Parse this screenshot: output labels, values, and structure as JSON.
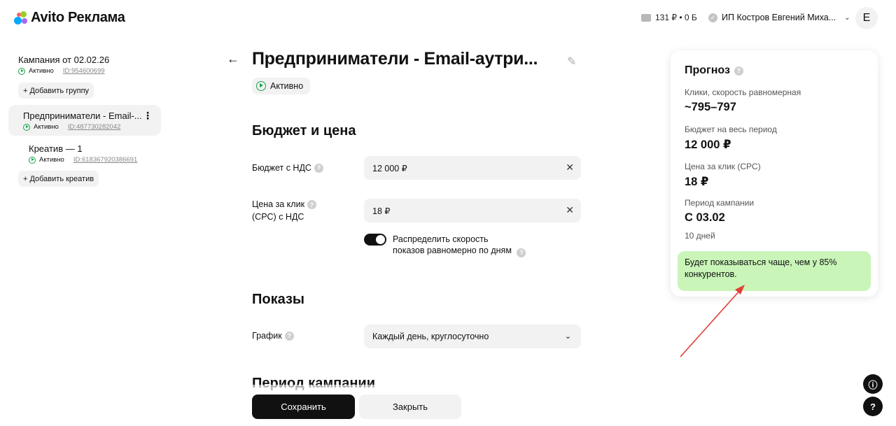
{
  "header": {
    "logo_text": "Avito Реклама",
    "wallet": "131 ₽ • 0 Б",
    "account_name": "ИП Костров Евгений Миха...",
    "avatar_letter": "Е"
  },
  "sidebar": {
    "campaign": {
      "title": "Кампания от 02.02.26",
      "status": "Активно",
      "id": "ID:954600699"
    },
    "add_group_label": "Добавить группу",
    "group": {
      "title": "Предприниматели - Email-...",
      "status": "Активно",
      "id": "ID:487730282042"
    },
    "creative": {
      "title": "Креатив — 1",
      "status": "Активно",
      "id": "ID:618367920386691"
    },
    "add_creative_label": "Добавить креатив"
  },
  "main": {
    "title": "Предприниматели - Email-аутри...",
    "status": "Активно",
    "budget_section": "Бюджет и цена",
    "budget_label": "Бюджет с НДС",
    "budget_value": "12 000 ₽",
    "cpc_label_line1": "Цена за клик",
    "cpc_label_line2": "(CPC) с НДС",
    "cpc_value": "18 ₽",
    "toggle_label_line1": "Распределить скорость",
    "toggle_label_line2": "показов равномерно по дням",
    "toggle_on": true,
    "shows_section": "Показы",
    "schedule_label": "График",
    "schedule_value": "Каждый день, круглосуточно",
    "period_section": "Период кампании",
    "save_label": "Сохранить",
    "close_label": "Закрыть"
  },
  "forecast": {
    "title": "Прогноз",
    "clicks_label": "Клики, скорость равномерная",
    "clicks_value": "~795–797",
    "budget_label": "Бюджет на весь период",
    "budget_value": "12 000 ₽",
    "cpc_label": "Цена за клик (CPC)",
    "cpc_value": "18 ₽",
    "period_label": "Период кампании",
    "period_value": "С 03.02",
    "period_days": "10 дней",
    "note": "Будет показываться чаще, чем у 85% конкурентов."
  },
  "colors": {
    "active_green": "#16a34a",
    "note_bg": "#c9f5b8",
    "annotation_red": "#e0403a",
    "primary_button": "#111111"
  }
}
